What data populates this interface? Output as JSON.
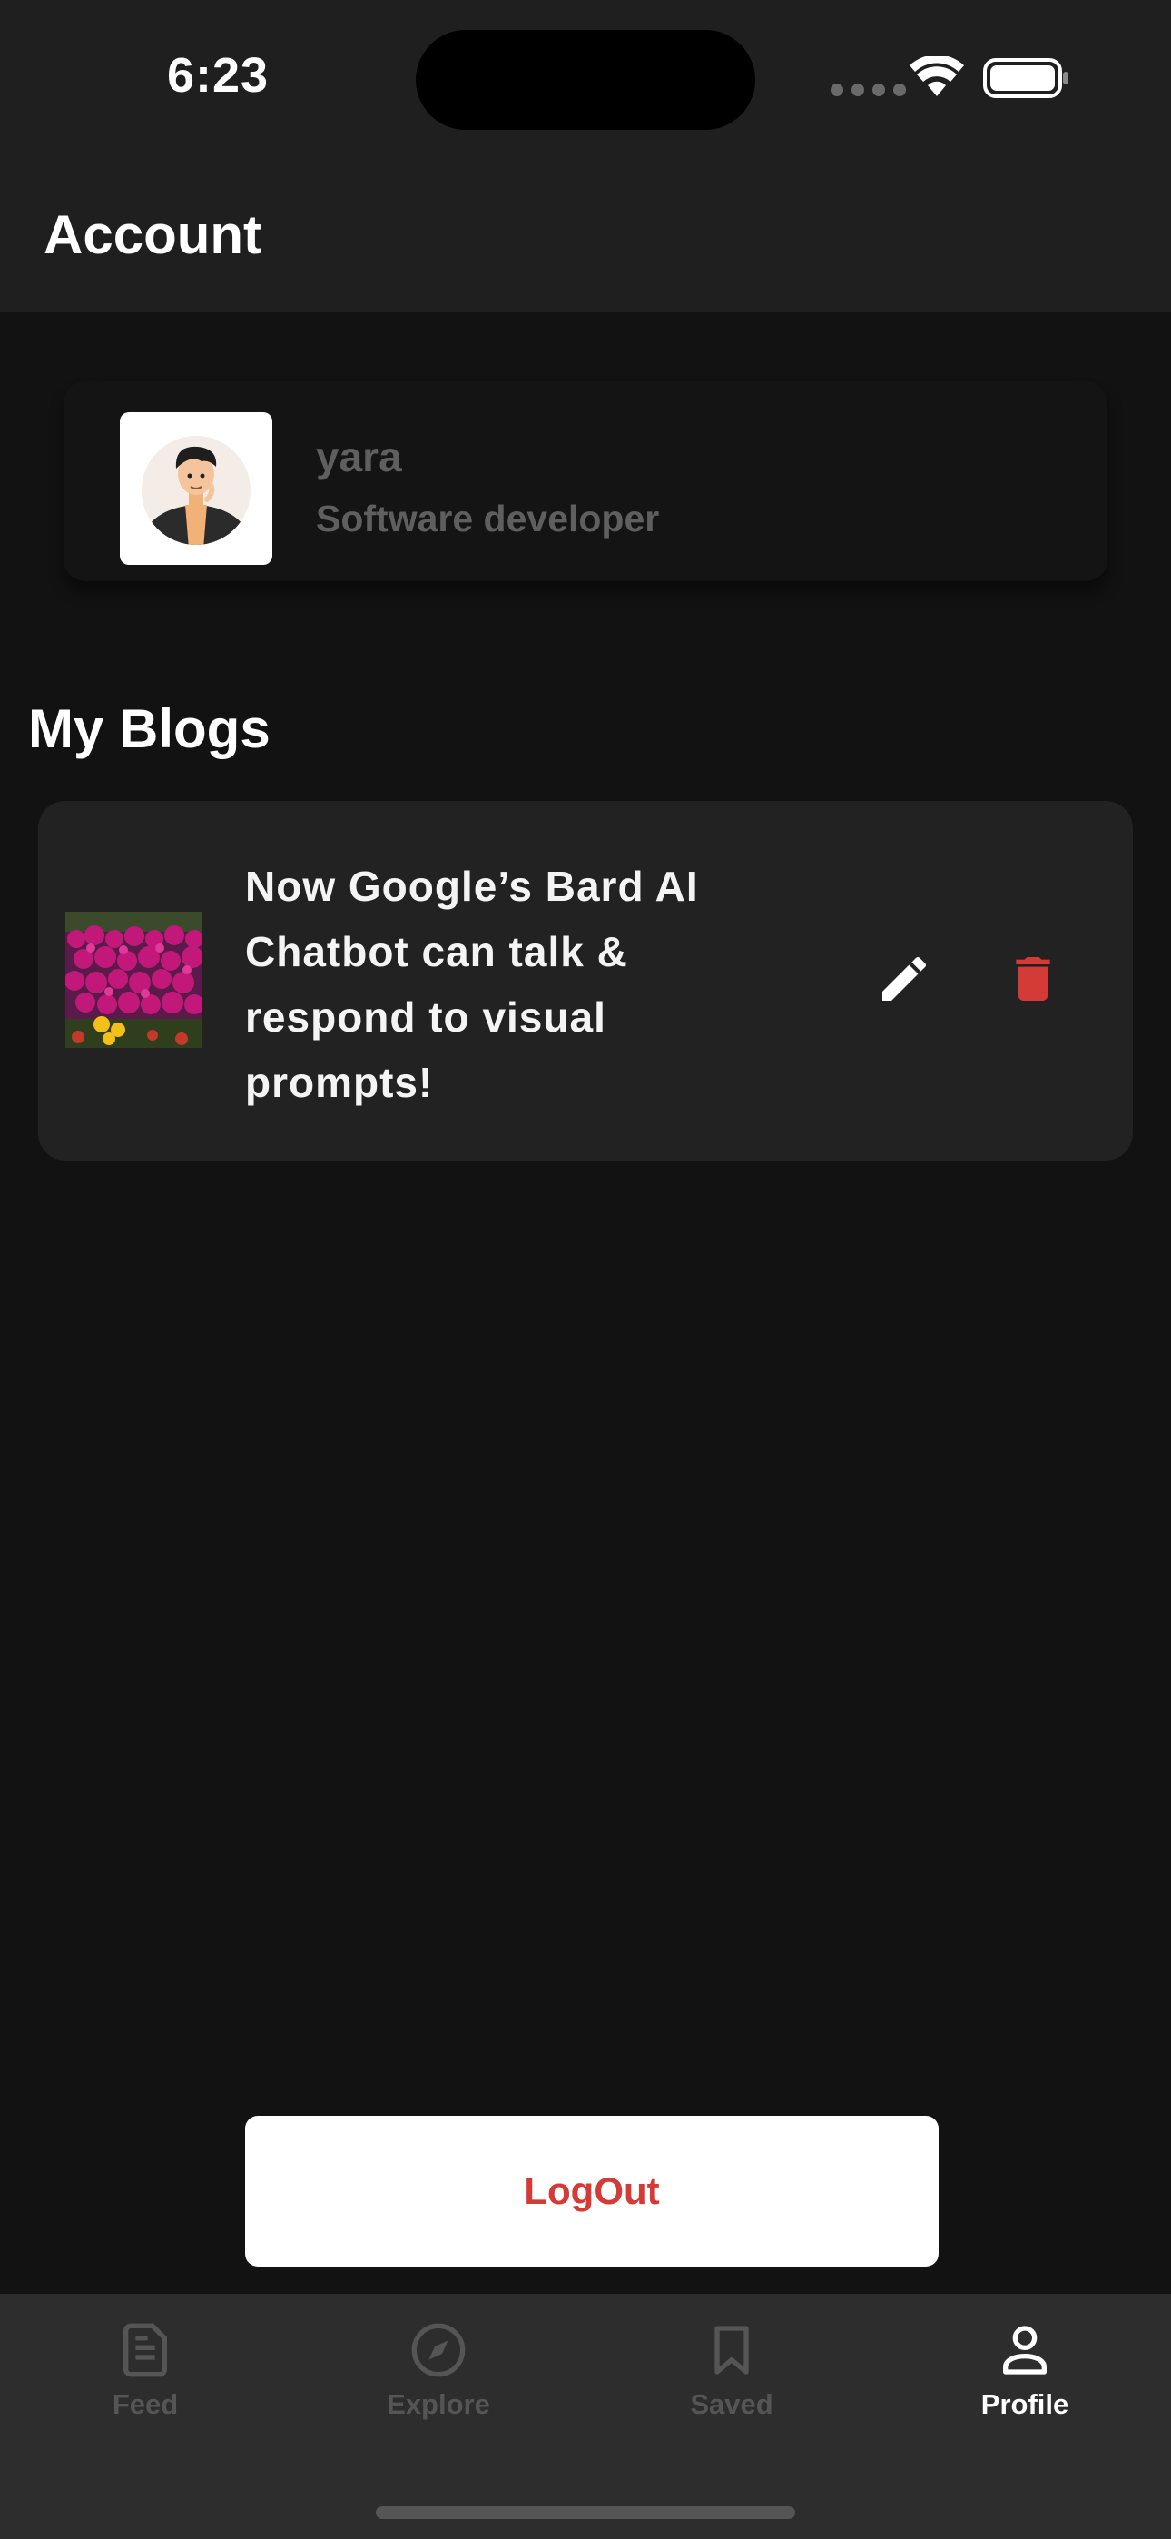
{
  "status_bar": {
    "time": "6:23"
  },
  "header": {
    "title": "Account"
  },
  "profile": {
    "name": "yara",
    "role": "Software developer"
  },
  "blogs_section": {
    "title": "My Blogs",
    "items": [
      {
        "title": "Now Google’s Bard AI Chatbot can talk &\n respond to visual prompts!"
      }
    ]
  },
  "logout": {
    "label": "LogOut"
  },
  "tab_bar": {
    "items": [
      {
        "label": "Feed",
        "icon": "document-icon",
        "active": false
      },
      {
        "label": "Explore",
        "icon": "compass-icon",
        "active": false
      },
      {
        "label": "Saved",
        "icon": "bookmark-icon",
        "active": false
      },
      {
        "label": "Profile",
        "icon": "person-icon",
        "active": true
      }
    ]
  },
  "colors": {
    "background": "#121212",
    "header": "#1f1f1f",
    "card": "#222222",
    "accent_red": "#d43a36",
    "tab_inactive": "#555555",
    "tab_active": "#ffffff"
  }
}
